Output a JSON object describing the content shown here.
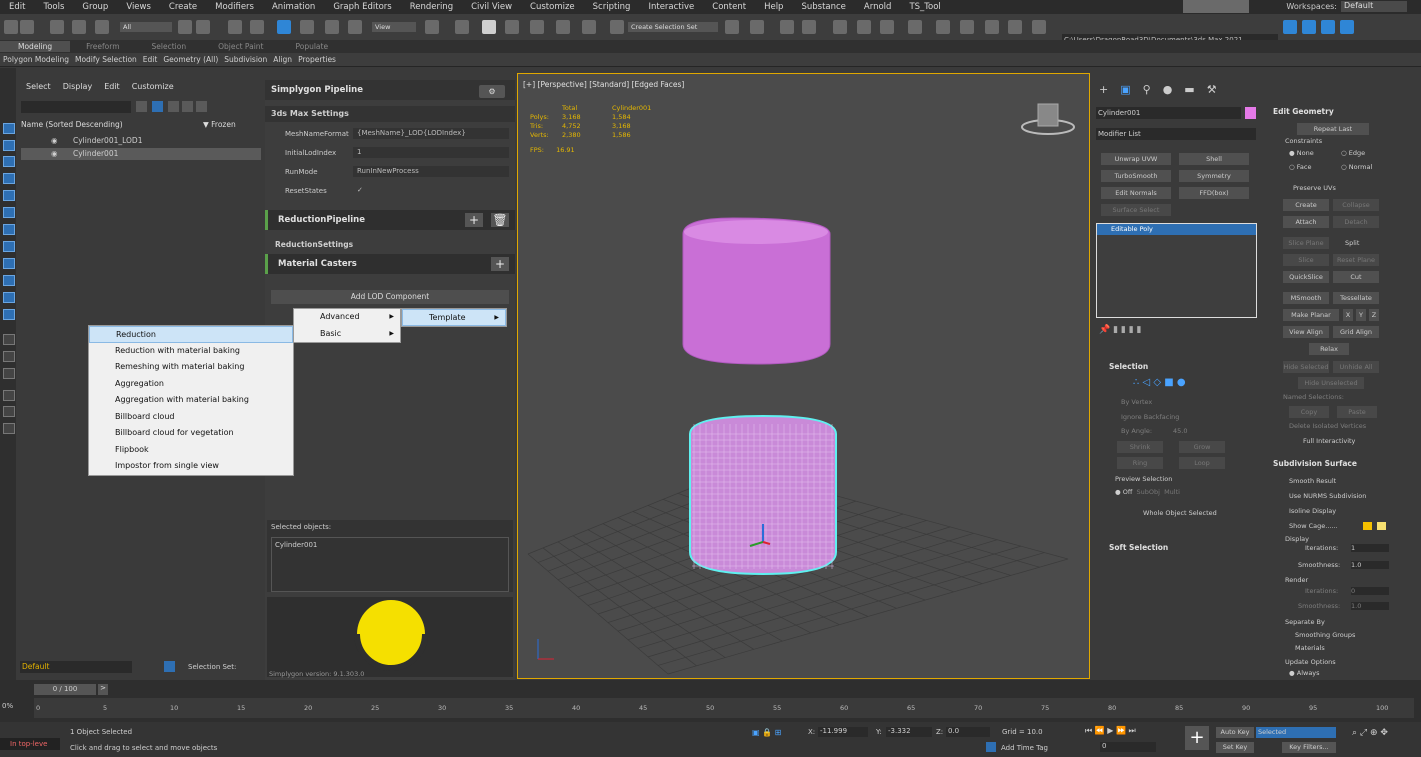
{
  "menu": [
    "Edit",
    "Tools",
    "Group",
    "Views",
    "Create",
    "Modifiers",
    "Animation",
    "Graph Editors",
    "Rendering",
    "Civil View",
    "Customize",
    "Scripting",
    "Interactive",
    "Content",
    "Help",
    "Substance",
    "Arnold",
    "TS_Tool"
  ],
  "workspaces_label": "Workspaces:",
  "workspace_value": "Default",
  "toolbar": {
    "filter_all": "All",
    "view": "View",
    "selset": "Create Selection Set",
    "path": "C:\\Users\\DragonRoad3D\\Documents\\3ds Max 2021"
  },
  "ribbon_tabs": [
    "Modeling",
    "Freeform",
    "Selection",
    "Object Paint",
    "Populate"
  ],
  "ribbon_sub": [
    "Polygon Modeling",
    "Modify Selection",
    "Edit",
    "Geometry (All)",
    "Subdivision",
    "Align",
    "Properties"
  ],
  "scene": {
    "tabs": [
      "Select",
      "Display",
      "Edit",
      "Customize"
    ],
    "col_name": "Name (Sorted Descending)",
    "col_frozen": "▼ Frozen",
    "items": [
      "Cylinder001_LOD1",
      "Cylinder001"
    ],
    "default_layer": "Default",
    "selection_set": "Selection Set:"
  },
  "simplygon": {
    "title": "Simplygon Pipeline",
    "settings": "3ds Max Settings",
    "props": [
      {
        "k": "MeshNameFormat",
        "v": "{MeshName}_LOD{LODIndex}"
      },
      {
        "k": "InitialLodIndex",
        "v": "1"
      },
      {
        "k": "RunMode",
        "v": "RunInNewProcess"
      },
      {
        "k": "ResetStates",
        "v": "✓"
      }
    ],
    "reduction_pipeline": "ReductionPipeline",
    "reduction_settings": "ReductionSettings",
    "material_casters": "Material Casters",
    "add_lod": "Add LOD Component",
    "selected_objects": "Selected objects:",
    "selected_value": "Cylinder001",
    "version": "Simplygon version: 9.1.303.0"
  },
  "context": {
    "level1": [
      "Advanced",
      "Basic"
    ],
    "level2": [
      "Template"
    ],
    "level3": [
      "Reduction",
      "Reduction with material baking",
      "Remeshing with material baking",
      "Aggregation",
      "Aggregation with material baking",
      "Billboard cloud",
      "Billboard cloud for vegetation",
      "Flipbook",
      "Impostor from single view"
    ]
  },
  "viewport": {
    "label": "[+] [Perspective] [Standard] [Edged Faces]",
    "stats_head": [
      "",
      "Total",
      "Cylinder001"
    ],
    "stats": [
      [
        "Polys:",
        "3,168",
        "1,584"
      ],
      [
        "Tris:",
        "4,752",
        "3,168"
      ],
      [
        "Verts:",
        "2,380",
        "1,586"
      ]
    ],
    "fps_label": "FPS:",
    "fps": "16.91"
  },
  "cmd": {
    "object_name": "Cylinder001",
    "modifier_list": "Modifier List",
    "mods": [
      "Unwrap UVW",
      "Shell",
      "TurboSmooth",
      "Symmetry",
      "Edit Normals",
      "FFD(box)",
      "Surface Select"
    ],
    "stack": "Editable Poly",
    "selection_title": "Selection",
    "sel_opts": [
      "By Vertex",
      "Ignore Backfacing",
      "By Angle:",
      "45.0",
      "Shrink",
      "Grow",
      "Ring",
      "Loop"
    ],
    "preview": "Preview Selection",
    "preview_opts": [
      "Off",
      "SubObj",
      "Multi"
    ],
    "whole": "Whole Object Selected",
    "soft": "Soft Selection",
    "edit_geom": "Edit Geometry",
    "repeat_last": "Repeat Last",
    "constraints": "Constraints",
    "c_opts": [
      "None",
      "Edge",
      "Face",
      "Normal"
    ],
    "preserve": "Preserve UVs",
    "create": "Create",
    "collapse": "Collapse",
    "attach": "Attach",
    "detach": "Detach",
    "slice_plane": "Slice Plane",
    "split": "Split",
    "slice": "Slice",
    "reset_plane": "Reset Plane",
    "quickslice": "QuickSlice",
    "cut": "Cut",
    "msmooth": "MSmooth",
    "tessellate": "Tessellate",
    "make_planar": "Make Planar",
    "x": "X",
    "y": "Y",
    "z": "Z",
    "view_align": "View Align",
    "grid_align": "Grid Align",
    "relax": "Relax",
    "hide_sel": "Hide Selected",
    "unhide": "Unhide All",
    "hide_unsel": "Hide Unselected",
    "named": "Named Selections:",
    "copy": "Copy",
    "paste": "Paste",
    "del_iso": "Delete Isolated Vertices",
    "full_inter": "Full Interactivity",
    "subdiv": "Subdivision Surface",
    "smooth_result": "Smooth Result",
    "nurms": "Use NURMS Subdivision",
    "isoline": "Isoline Display",
    "show_cage": "Show Cage......",
    "display": "Display",
    "iterations": "Iterations:",
    "smoothness": "Smoothness:",
    "render": "Render",
    "it_val": "1",
    "sm_val": "1.0",
    "it_r": "0",
    "sep": "Separate By",
    "sg": "Smoothing Groups",
    "mat": "Materials",
    "update": "Update Options",
    "always": "Always"
  },
  "bottom": {
    "frame": "0 / 100",
    "ticks": [
      "0",
      "5",
      "10",
      "15",
      "20",
      "25",
      "30",
      "35",
      "40",
      "45",
      "50",
      "55",
      "60",
      "65",
      "70",
      "75",
      "80",
      "85",
      "90",
      "95",
      "100"
    ],
    "obj_sel": "1 Object Selected",
    "hint": "Click and drag to select and move objects",
    "toplevel": "In top-leve",
    "x_label": "X:",
    "x": "-11.999",
    "y_label": "Y:",
    "y": "-3.332",
    "z_label": "Z:",
    "z": "0.0",
    "grid": "Grid = 10.0",
    "add_time": "Add Time Tag",
    "autokey": "Auto Key",
    "selected": "Selected",
    "setkey": "Set Key",
    "keyfilters": "Key Filters...",
    "frame_val": "0",
    "pct": "0%"
  }
}
